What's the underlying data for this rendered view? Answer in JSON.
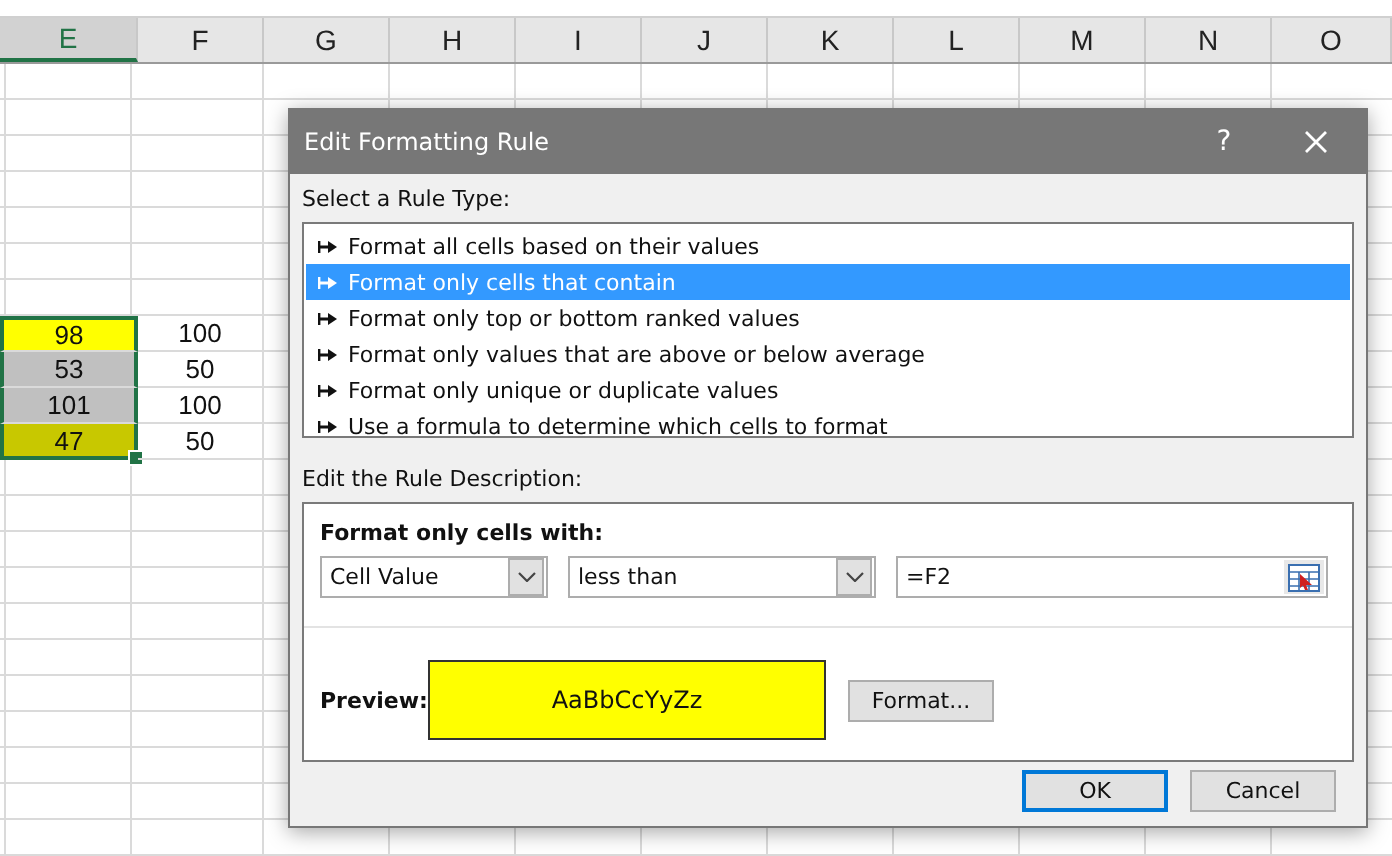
{
  "sheet": {
    "columns": [
      {
        "label": "E",
        "selected": true
      },
      {
        "label": "F",
        "selected": false
      },
      {
        "label": "G",
        "selected": false
      },
      {
        "label": "H",
        "selected": false
      },
      {
        "label": "I",
        "selected": false
      },
      {
        "label": "J",
        "selected": false
      },
      {
        "label": "K",
        "selected": false
      },
      {
        "label": "L",
        "selected": false
      },
      {
        "label": "M",
        "selected": false
      },
      {
        "label": "N",
        "selected": false
      },
      {
        "label": "O",
        "selected": false
      }
    ],
    "rows": [
      {
        "cells": [
          {
            "value": "98",
            "color": "#ffff00",
            "selected": true
          },
          {
            "value": "100",
            "selected": false
          }
        ]
      },
      {
        "cells": [
          {
            "value": "53",
            "color": "#c0c0c0",
            "selected": true
          },
          {
            "value": "50",
            "selected": false
          }
        ]
      },
      {
        "cells": [
          {
            "value": "101",
            "color": "#c0c0c0",
            "selected": true
          },
          {
            "value": "100",
            "selected": false
          }
        ]
      },
      {
        "cells": [
          {
            "value": "47",
            "color": "#c8c800",
            "selected": true
          },
          {
            "value": "50",
            "selected": false
          }
        ]
      }
    ]
  },
  "dialog": {
    "title": "Edit Formatting Rule",
    "help": "?",
    "rule_type_label": "Select a Rule Type:",
    "rule_types": [
      {
        "label": "Format all cells based on their values",
        "selected": false
      },
      {
        "label": "Format only cells that contain",
        "selected": true
      },
      {
        "label": "Format only top or bottom ranked values",
        "selected": false
      },
      {
        "label": "Format only values that are above or below average",
        "selected": false
      },
      {
        "label": "Format only unique or duplicate values",
        "selected": false
      },
      {
        "label": "Use a formula to determine which cells to format",
        "selected": false
      }
    ],
    "description_label": "Edit the Rule Description:",
    "condition_label": "Format only cells with:",
    "condition_subject": "Cell Value",
    "condition_operator": "less than",
    "condition_value": "=F2",
    "preview_label": "Preview:",
    "preview": {
      "text": "AaBbCcYyZz",
      "color": "#ffff00"
    },
    "format_button": "Format...",
    "buttons": [
      {
        "label": "OK",
        "default": true
      },
      {
        "label": "Cancel",
        "default": false
      }
    ]
  }
}
